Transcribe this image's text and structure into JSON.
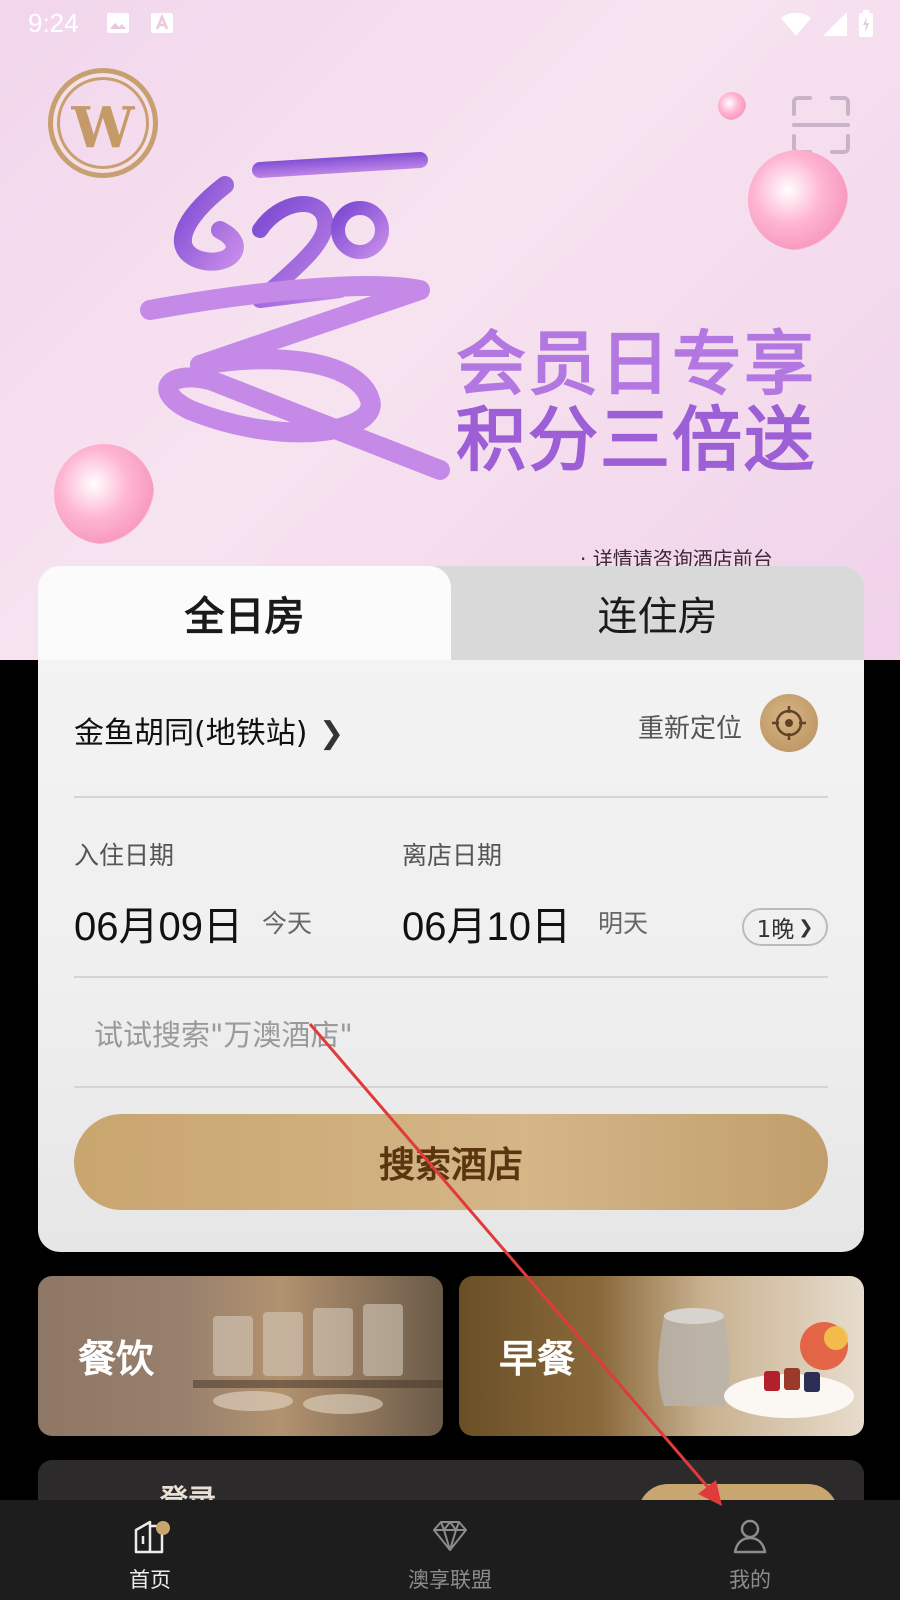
{
  "status_bar": {
    "time": "9:24",
    "icons": [
      "image-icon",
      "font-icon",
      "wifi-icon",
      "signal-icon",
      "battery-icon"
    ]
  },
  "banner": {
    "logo_letter": "W",
    "headline_line1": "会员日专享",
    "headline_line2": "积分三倍送",
    "note": "· 详情请咨询酒店前台",
    "colors": {
      "accent": "#9c5fd6",
      "background": "#f2d6ec"
    }
  },
  "booking": {
    "tabs": [
      {
        "label": "全日房",
        "active": true
      },
      {
        "label": "连住房",
        "active": false
      }
    ],
    "location": "金鱼胡同(地铁站)",
    "relocate_label": "重新定位",
    "checkin": {
      "label": "入住日期",
      "date": "06月09日",
      "hint": "今天"
    },
    "checkout": {
      "label": "离店日期",
      "date": "06月10日",
      "hint": "明天"
    },
    "nights": "1晚",
    "search_placeholder": "试试搜索\"万澳酒店\"",
    "search_button": "搜索酒店",
    "colors": {
      "gold": "#c9a56f",
      "button_text": "#5a3510"
    }
  },
  "tiles": [
    {
      "label": "餐饮"
    },
    {
      "label": "早餐"
    }
  ],
  "login_strip": {
    "label": "登录"
  },
  "bottom_nav": [
    {
      "label": "首页",
      "icon": "home-icon",
      "active": true
    },
    {
      "label": "澳享联盟",
      "icon": "diamond-icon",
      "active": false
    },
    {
      "label": "我的",
      "icon": "user-icon",
      "active": false
    }
  ]
}
